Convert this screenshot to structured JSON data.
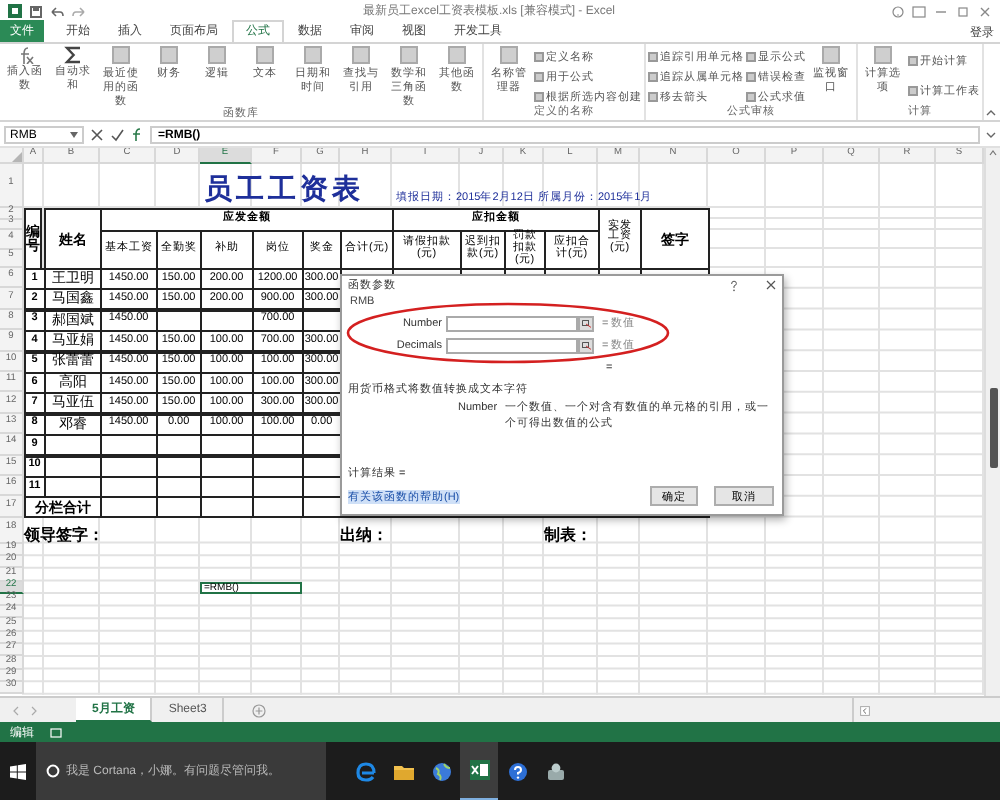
{
  "window": {
    "title": "最新员工excel工资表模板.xls [兼容模式] - Excel"
  },
  "ribbon": {
    "tabs": [
      {
        "label": "文件",
        "kind": "file",
        "selected": false
      },
      {
        "label": "开始",
        "kind": "tab",
        "selected": false
      },
      {
        "label": "插入",
        "kind": "tab",
        "selected": false
      },
      {
        "label": "页面布局",
        "kind": "tab",
        "selected": false
      },
      {
        "label": "公式",
        "kind": "tab",
        "selected": true
      },
      {
        "label": "数据",
        "kind": "tab",
        "selected": false
      },
      {
        "label": "审阅",
        "kind": "tab",
        "selected": false
      },
      {
        "label": "视图",
        "kind": "tab",
        "selected": false
      },
      {
        "label": "开发工具",
        "kind": "tab",
        "selected": false
      }
    ],
    "account": "登录",
    "groups": [
      {
        "label": "函数库",
        "items": [
          {
            "label": "插入函数",
            "kind": "large"
          },
          {
            "label": "自动求和",
            "kind": "large"
          },
          {
            "label": "最近使用的函数",
            "kind": "large"
          },
          {
            "label": "财务",
            "kind": "large"
          },
          {
            "label": "逻辑",
            "kind": "large"
          },
          {
            "label": "文本",
            "kind": "large"
          },
          {
            "label": "日期和时间",
            "kind": "large"
          },
          {
            "label": "查找与引用",
            "kind": "large"
          },
          {
            "label": "数学和三角函数",
            "kind": "large"
          },
          {
            "label": "其他函数",
            "kind": "large"
          }
        ]
      },
      {
        "label": "定义的名称",
        "items": [
          {
            "label": "名称管理器",
            "kind": "large"
          },
          {
            "label": "定义名称",
            "kind": "small"
          },
          {
            "label": "用于公式",
            "kind": "small"
          },
          {
            "label": "根据所选内容创建",
            "kind": "small"
          }
        ]
      },
      {
        "label": "公式审核",
        "items": [
          {
            "label": "追踪引用单元格",
            "kind": "small"
          },
          {
            "label": "追踪从属单元格",
            "kind": "small"
          },
          {
            "label": "移去箭头",
            "kind": "small"
          },
          {
            "label": "显示公式",
            "kind": "small"
          },
          {
            "label": "错误检查",
            "kind": "small"
          },
          {
            "label": "公式求值",
            "kind": "small"
          },
          {
            "label": "监视窗口",
            "kind": "large"
          }
        ]
      },
      {
        "label": "计算",
        "items": [
          {
            "label": "计算选项",
            "kind": "large"
          },
          {
            "label": "开始计算",
            "kind": "small"
          },
          {
            "label": "计算工作表",
            "kind": "small"
          }
        ]
      }
    ]
  },
  "formula_bar": {
    "name_box": "RMB",
    "formula": "=RMB()"
  },
  "sheet": {
    "columns": [
      "A",
      "B",
      "C",
      "D",
      "E",
      "F",
      "G",
      "H",
      "I",
      "J",
      "K",
      "L",
      "M",
      "N",
      "O",
      "P",
      "Q",
      "R",
      "S"
    ],
    "row_numbers": [
      "1",
      "2",
      "3",
      "4",
      "5",
      "6",
      "7",
      "8",
      "9",
      "10",
      "11",
      "12",
      "13",
      "14",
      "15",
      "16",
      "17",
      "18",
      "19",
      "20",
      "21",
      "22",
      "23",
      "24",
      "25",
      "26",
      "27",
      "28",
      "29",
      "30"
    ],
    "title": "员工工资表",
    "date_info": "填报日期：2015年2月12日  所属月份：2015年1月",
    "headers": {
      "number": "编号",
      "name": "姓名",
      "income": "应发金额",
      "income_items": [
        "基本工资",
        "全勤奖",
        "补助",
        "岗位",
        "奖金",
        "合计(元)"
      ],
      "deduction": "应扣金额",
      "deduction_items": [
        "请假扣款(元)",
        "迟到扣款(元)",
        "罚款扣款(元)",
        "应扣合计(元)"
      ],
      "net": "实发工资(元)",
      "signature": "签字"
    },
    "records": [
      {
        "no": "1",
        "name": "王卫明",
        "basic": "1450.00",
        "attendance": "150.00",
        "allowance": "200.00",
        "post": "1200.00",
        "bonus": "300.00"
      },
      {
        "no": "2",
        "name": "马国鑫",
        "basic": "1450.00",
        "attendance": "150.00",
        "allowance": "200.00",
        "post": "900.00",
        "bonus": "300.00"
      },
      {
        "no": "3",
        "name": "郝国斌",
        "basic": "1450.00",
        "post": "700.00"
      },
      {
        "no": "4",
        "name": "马亚娟",
        "basic": "1450.00",
        "attendance": "150.00",
        "allowance": "100.00",
        "post": "700.00",
        "bonus": "300.00"
      },
      {
        "no": "5",
        "name": "张蕾蕾",
        "basic": "1450.00",
        "attendance": "150.00",
        "allowance": "100.00",
        "post": "100.00",
        "bonus": "300.00"
      },
      {
        "no": "6",
        "name": "高阳",
        "basic": "1450.00",
        "attendance": "150.00",
        "allowance": "100.00",
        "post": "100.00",
        "bonus": "300.00"
      },
      {
        "no": "7",
        "name": "马亚伍",
        "basic": "1450.00",
        "attendance": "150.00",
        "allowance": "100.00",
        "post": "300.00",
        "bonus": "300.00"
      },
      {
        "no": "8",
        "name": "邓睿",
        "basic": "1450.00",
        "attendance": "0.00",
        "allowance": "100.00",
        "post": "100.00",
        "bonus": "0.00"
      }
    ],
    "empty_numbers": [
      "9",
      "10",
      "11"
    ],
    "total_label": "分栏合计",
    "sign_labels": [
      "领导签字：",
      "出纳：",
      "制表："
    ],
    "active_cell": {
      "text": "=RMB()"
    }
  },
  "dialog": {
    "title": "函数参数",
    "function_name": "RMB",
    "args": [
      {
        "label": "Number",
        "result": "= 数值"
      },
      {
        "label": "Decimals",
        "result": "= 数值"
      }
    ],
    "formula_result": "=",
    "description": "用货币格式将数值转换成文本字符",
    "arg_help_label": "Number",
    "arg_help": "一个数值、一个对含有数值的单元格的引用，或一个可得出数值的公式",
    "result_label": "计算结果 =",
    "help_link": "有关该函数的帮助(H)",
    "buttons": [
      "确定",
      "取消"
    ],
    "highlight": {
      "kind": "ellipse"
    }
  },
  "sheet_tabs": [
    {
      "label": "5月工资",
      "selected": true
    },
    {
      "label": "Sheet3",
      "selected": false
    }
  ],
  "status_bar": {
    "mode": "编辑"
  },
  "taskbar": {
    "search_placeholder": "我是 Cortana，小娜。有问题尽管问我。",
    "apps": [
      {
        "kind": "edge",
        "active": false
      },
      {
        "kind": "folder",
        "active": false
      },
      {
        "kind": "globe",
        "active": false
      },
      {
        "kind": "excel",
        "active": true
      },
      {
        "kind": "help",
        "active": false
      },
      {
        "kind": "tool",
        "active": false
      }
    ]
  }
}
